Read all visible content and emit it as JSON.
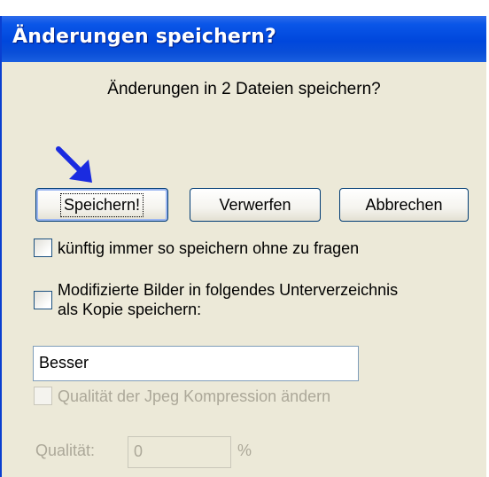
{
  "dialog": {
    "title": "Änderungen speichern?",
    "message": "Änderungen in 2 Dateien speichern?"
  },
  "buttons": {
    "save": "Speichern!",
    "discard": "Verwerfen",
    "cancel": "Abbrechen"
  },
  "options": {
    "always_save": {
      "label": "künftig immer so speichern ohne zu fragen",
      "checked": false,
      "enabled": true
    },
    "save_copy": {
      "label_line1": "Modifizierte Bilder in folgendes Unterverzeichnis",
      "label_line2": "als Kopie speichern:",
      "checked": false,
      "enabled": true
    },
    "subfolder": {
      "value": "Besser"
    },
    "change_quality": {
      "label": "Qualität der Jpeg Kompression ändern",
      "checked": false,
      "enabled": false
    },
    "quality": {
      "label": "Qualität:",
      "value": "0",
      "unit": "%",
      "enabled": false
    }
  },
  "annotation": {
    "arrow_color": "#1a2be0",
    "arrow_icon": "arrow-down-right-icon"
  },
  "colors": {
    "titlebar": "#0047dc",
    "dialog_bg": "#ece9d8",
    "disabled_text": "#aca899"
  }
}
